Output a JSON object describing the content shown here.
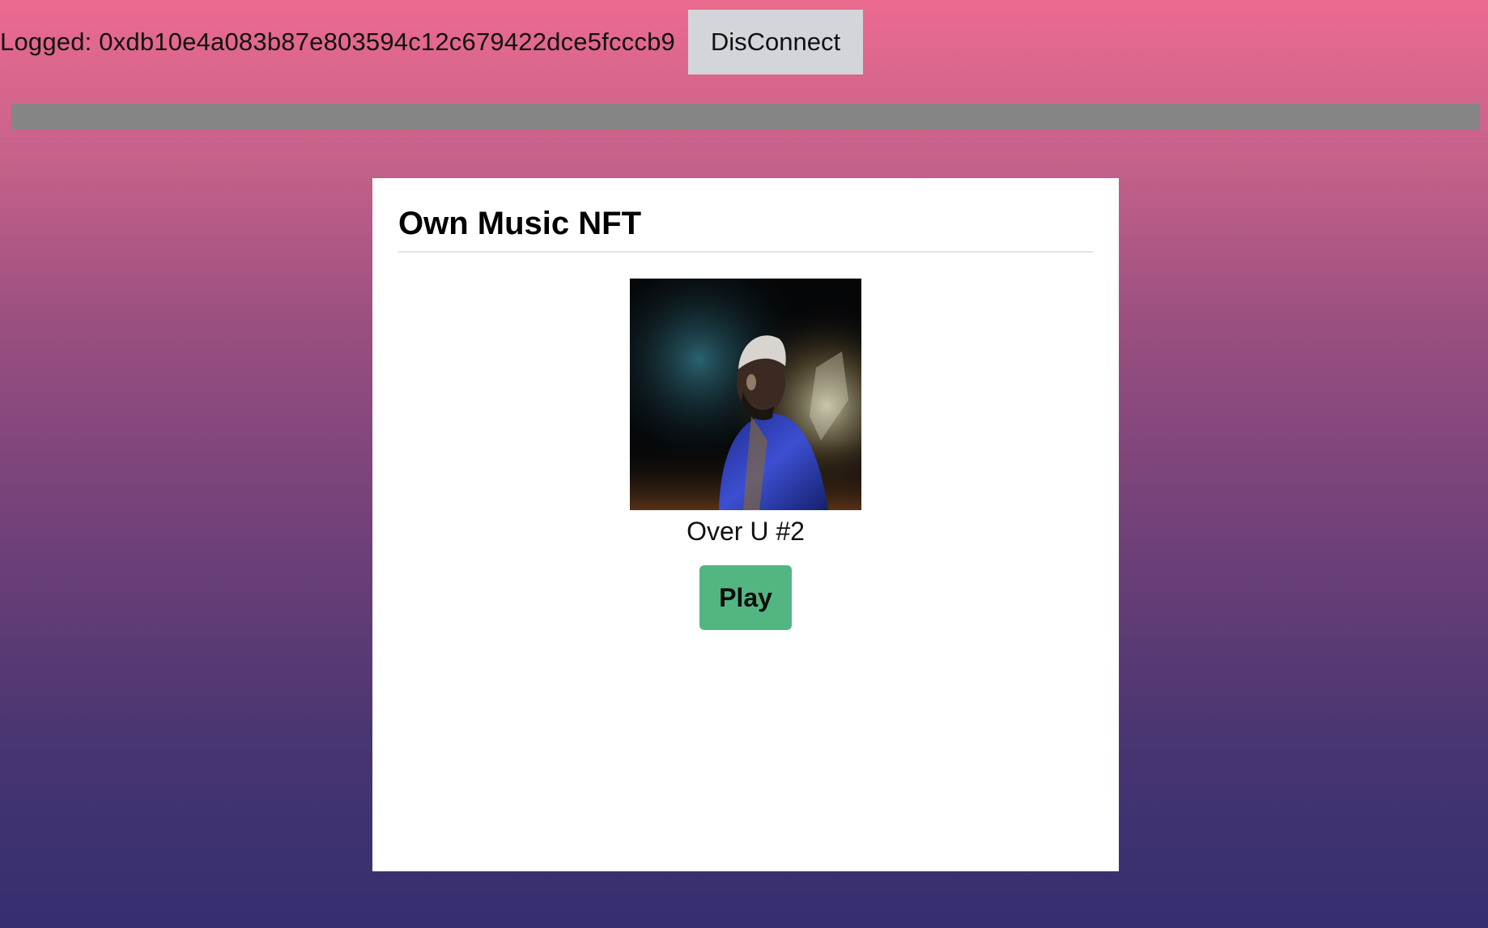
{
  "header": {
    "logged_text": "Logged: 0xdb10e4a083b87e803594c12c679422dce5fcccb9",
    "disconnect_label": "DisConnect"
  },
  "progress": {
    "fraction": 1.0
  },
  "card": {
    "title": "Own Music NFT",
    "nft": {
      "name": "Over U #2",
      "image": "album-cover-portrait-photo",
      "play_label": "Play"
    }
  },
  "colors": {
    "gradient_top": "#ec6a90",
    "gradient_bottom": "#352e70",
    "play_button": "#52b683",
    "disconnect_button": "#d2d6da",
    "progress_bar": "#858585"
  }
}
